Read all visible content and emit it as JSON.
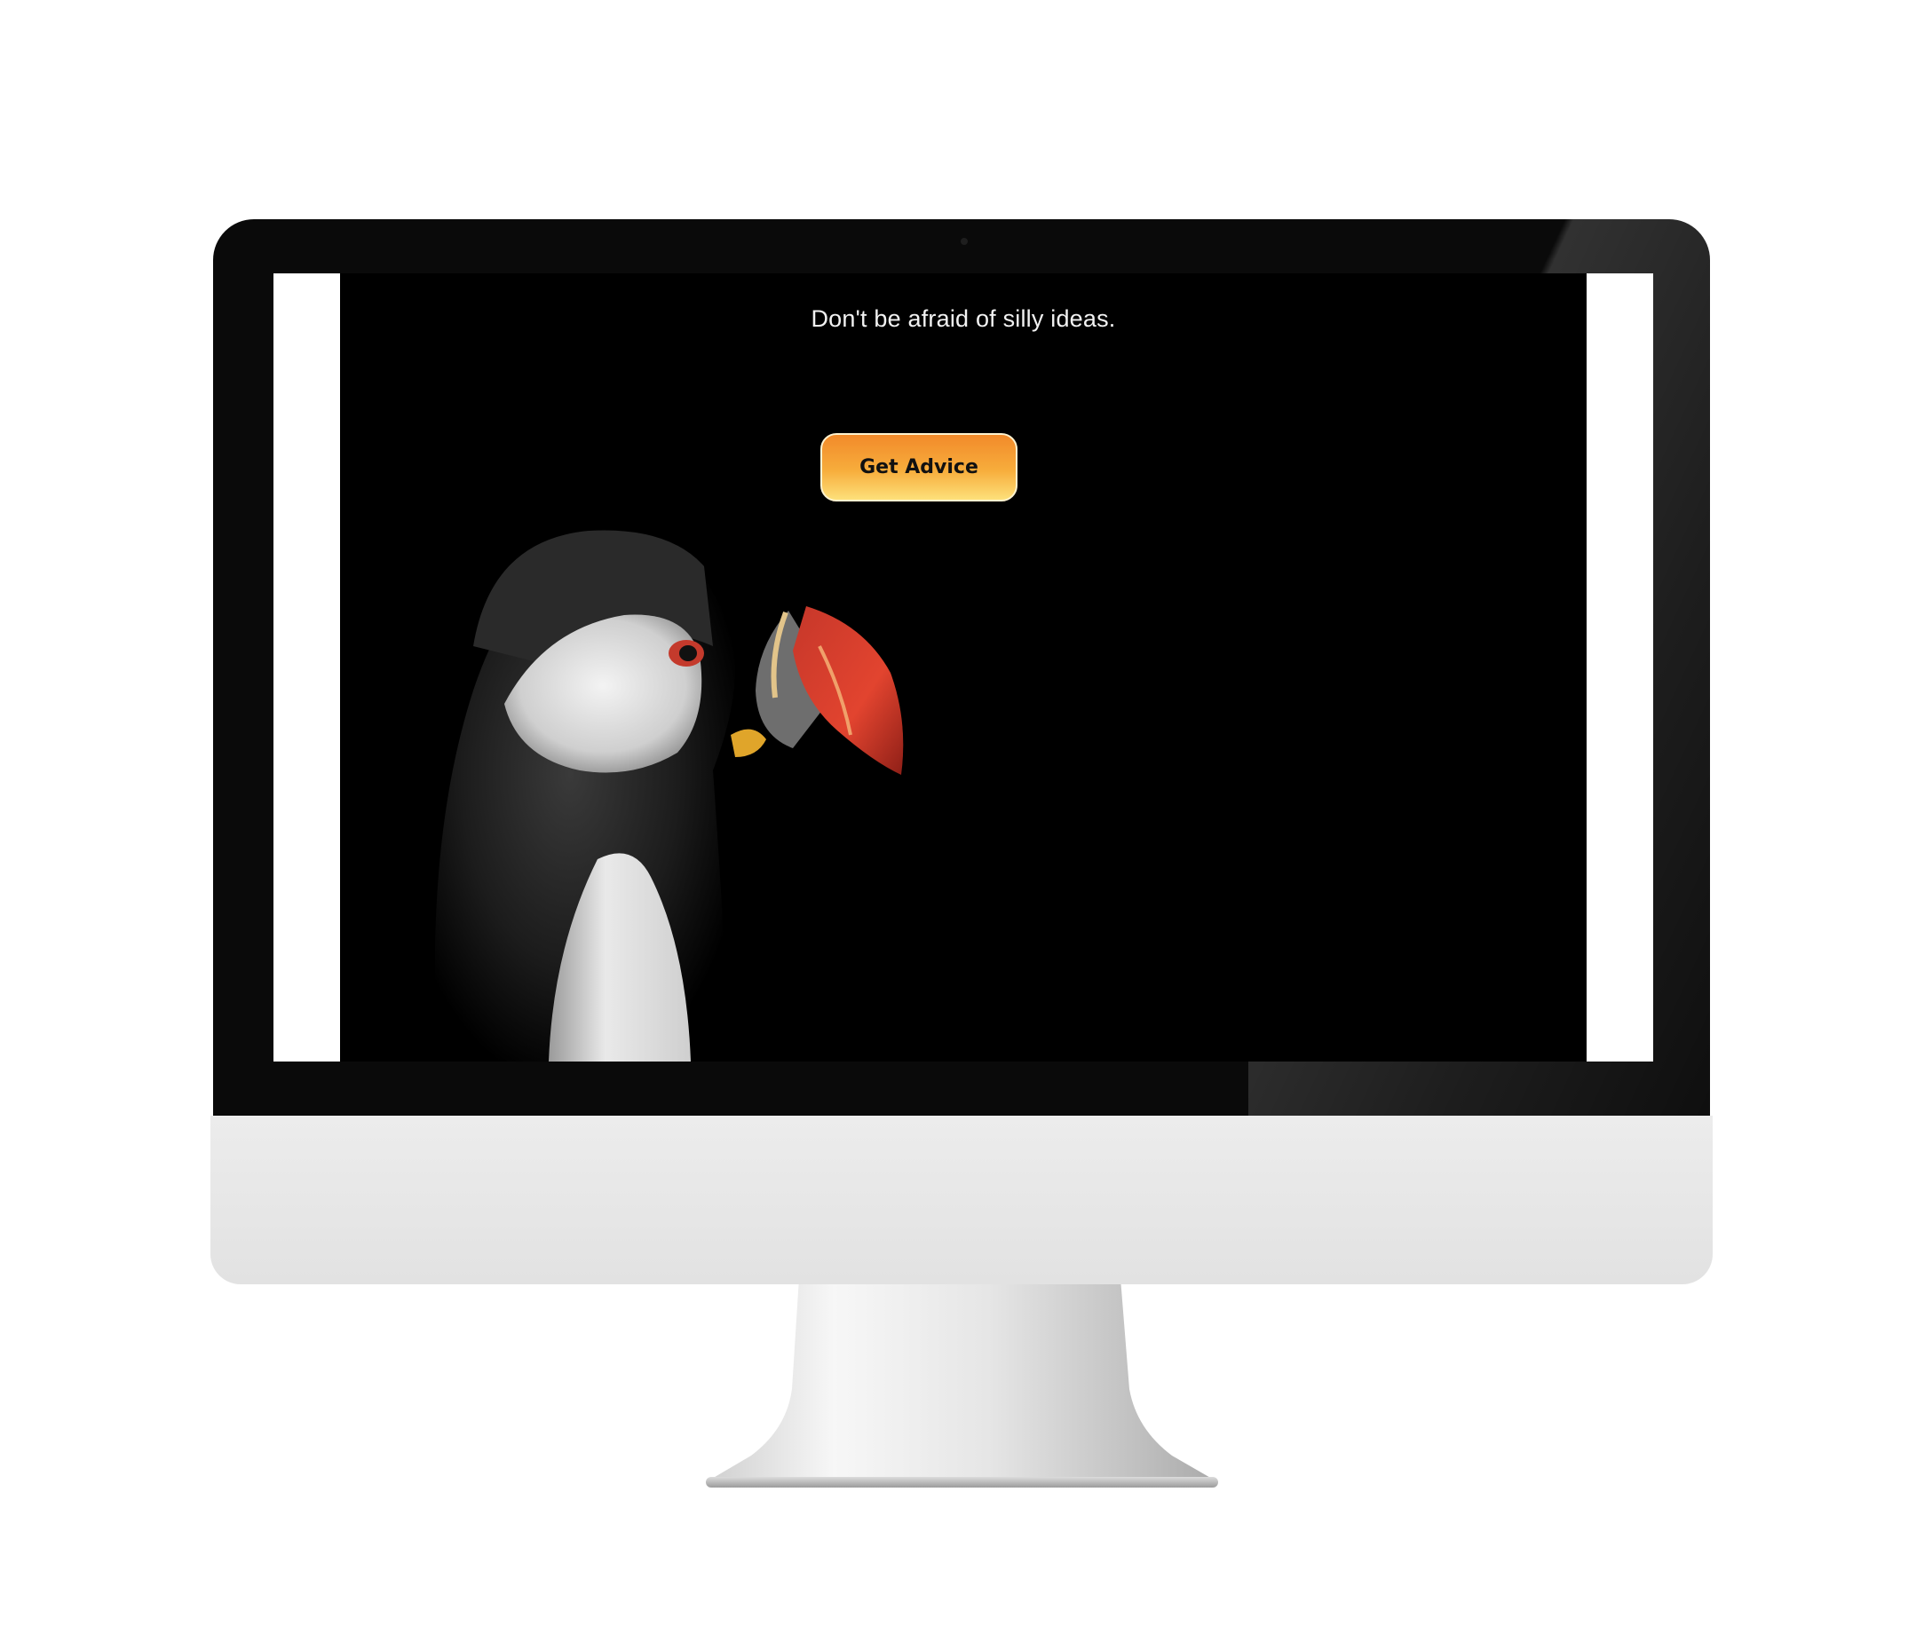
{
  "page": {
    "tagline": "Don't be afraid of silly ideas.",
    "cta_label": "Get Advice"
  },
  "colors": {
    "page_background": "#000000",
    "button_gradient_top": "#f28a2a",
    "button_gradient_bottom": "#fde07a",
    "button_border": "#fff3cf",
    "tagline_text": "#f2f2f2",
    "monitor_bezel": "#0a0a0a",
    "monitor_chin": "#e6e6e6"
  },
  "imagery": {
    "hero_subject": "puffin-photo"
  }
}
